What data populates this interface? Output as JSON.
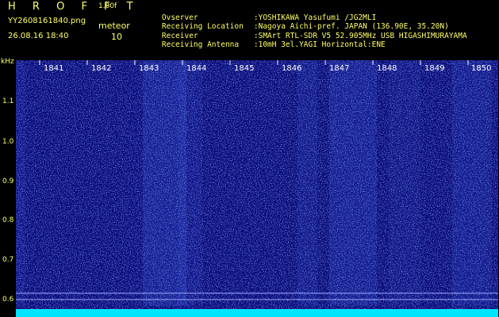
{
  "header": {
    "app_title": "H R O F F T",
    "version": "1.00f",
    "filename": "YY2608161840.png",
    "meteor_label": "meteor",
    "datetime": "26.08.16 18:40",
    "meteor_count": "10"
  },
  "info": [
    {
      "key": "Ovserver",
      "value": ":YOSHIKAWA Yasufumi /JG2MLI"
    },
    {
      "key": "Receiving Location",
      "value": ":Nagoya Aichi-pref. JAPAN (136.90E, 35.20N)"
    },
    {
      "key": "Receiver",
      "value": ":SMArt RTL-SDR V5 52.905MHz USB HIGASHIMURAYAMA"
    },
    {
      "key": "Receiving Antenna",
      "value": ":10mH 3el.YAGI Horizontal:ENE"
    }
  ],
  "axis": {
    "unit": "kHz",
    "y_labels": [
      "1.1",
      "1.0",
      "0.9",
      "0.8",
      "0.7",
      "0.6"
    ],
    "time_labels": [
      "1841",
      "1842",
      "1843",
      "1844",
      "1845",
      "1846",
      "1847",
      "1848",
      "1849",
      "1850"
    ]
  },
  "colors": {
    "background": "#000000",
    "text": "#ffff66",
    "spectrogram": "#0b0b78",
    "noise": "#3a5cff",
    "baseline": "#00e5ff"
  }
}
